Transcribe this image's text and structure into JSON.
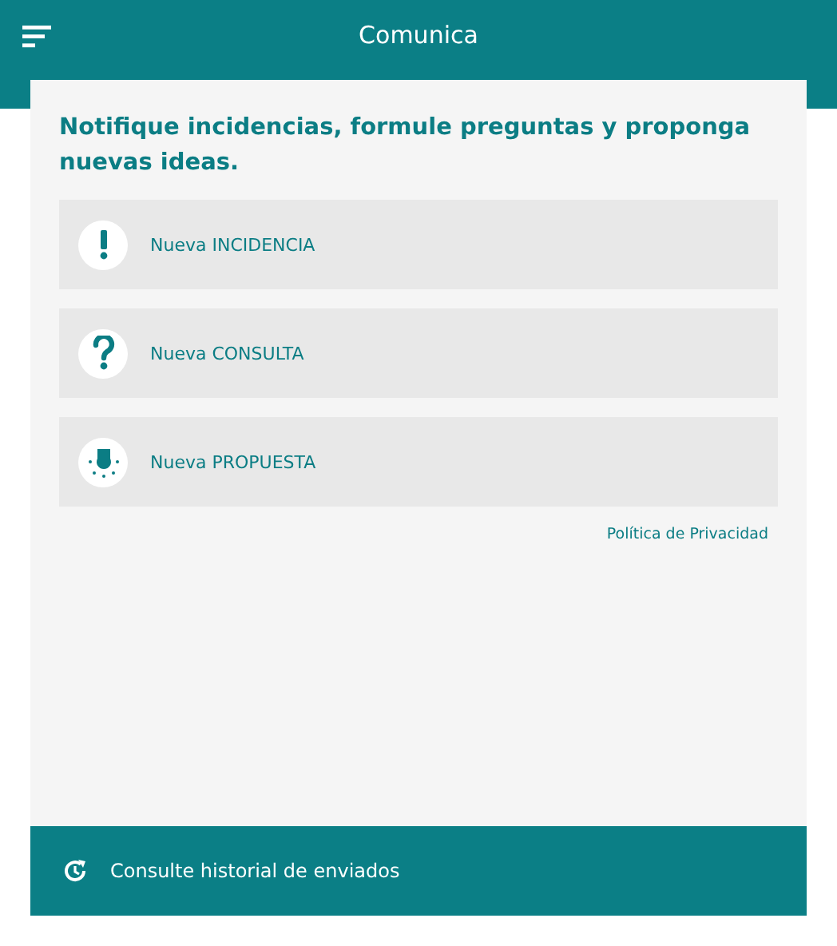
{
  "header": {
    "title": "Comunica"
  },
  "intro": "Notifique incidencias, formule preguntas y  proponga nuevas ideas.",
  "options": [
    {
      "kind": "alert",
      "label": "Nueva INCIDENCIA"
    },
    {
      "kind": "question",
      "label": "Nueva CONSULTA"
    },
    {
      "kind": "idea",
      "label": "Nueva PROPUESTA"
    }
  ],
  "privacy_link": "Política de Privacidad",
  "history_bar": {
    "label": "Consulte historial de enviados"
  }
}
